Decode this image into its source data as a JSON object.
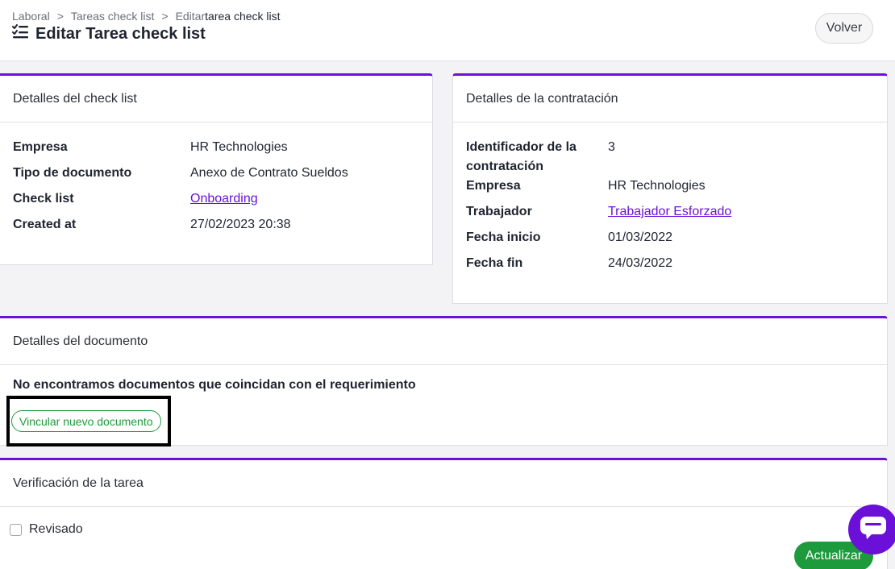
{
  "breadcrumb": {
    "items": [
      "Laboral",
      "Tareas check list"
    ],
    "current_prefix": "Editar",
    "current": "tarea check list",
    "separator": ">"
  },
  "header": {
    "title": "Editar Tarea check list",
    "back_label": "Volver"
  },
  "checklist_card": {
    "title": "Detalles del check list",
    "rows": [
      {
        "label": "Empresa",
        "value": "HR Technologies"
      },
      {
        "label": "Tipo de documento",
        "value": "Anexo de Contrato Sueldos"
      },
      {
        "label": "Check list",
        "value": "Onboarding"
      },
      {
        "label": "Created at",
        "value": "27/02/2023 20:38"
      }
    ]
  },
  "contract_card": {
    "title": "Detalles de la contratación",
    "rows": [
      {
        "label_line1": "Identificador de la",
        "label_line2": "contratación",
        "value": "3"
      },
      {
        "label": "Empresa",
        "value": "HR Technologies"
      },
      {
        "label": "Trabajador",
        "value": "Trabajador Esforzado"
      },
      {
        "label": "Fecha inicio",
        "value": "01/03/2022"
      },
      {
        "label": "Fecha fin",
        "value": "24/03/2022"
      }
    ]
  },
  "document_card": {
    "title": "Detalles del documento",
    "empty_message": "No encontramos documentos que coincidan con el requerimiento",
    "link_button": "Vincular nuevo documento"
  },
  "verification_card": {
    "title": "Verificación de la tarea",
    "checkbox_label": "Revisado",
    "checked": false
  },
  "actions": {
    "update_label": "Actualizar"
  },
  "colors": {
    "accent": "#6a10d8",
    "success": "#1d9a3c"
  },
  "icons": {
    "title_icon": "checklist-icon",
    "chat_icon": "chat-icon"
  }
}
